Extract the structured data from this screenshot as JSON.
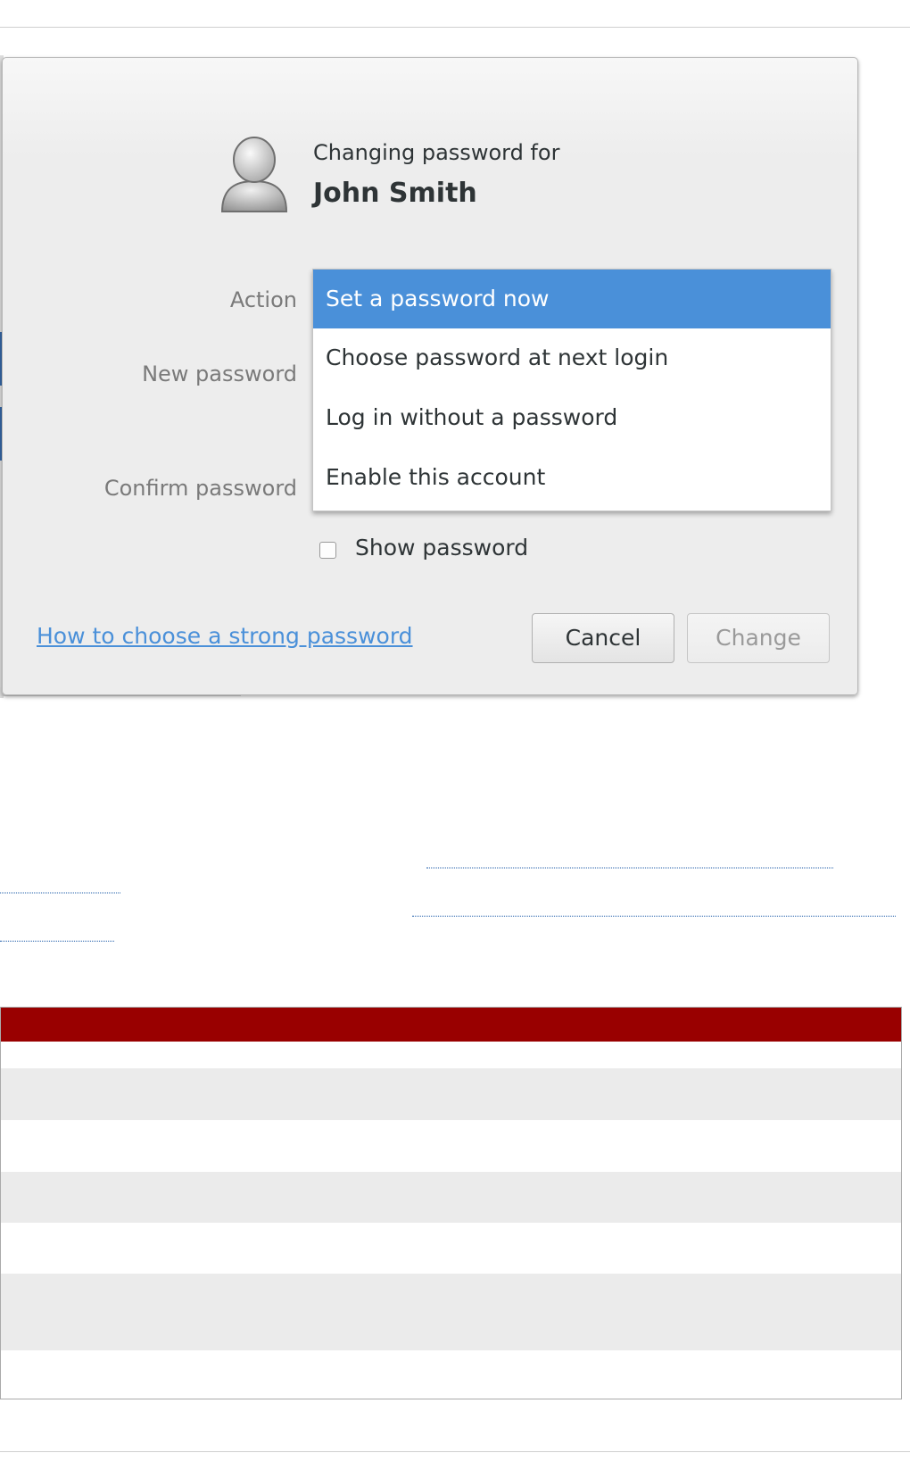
{
  "dialog": {
    "caption": "Changing password for",
    "user_name": "John Smith",
    "labels": {
      "action": "Action",
      "new_password": "New password",
      "confirm_password": "Confirm password"
    },
    "action_menu": {
      "selected_index": 0,
      "options": [
        "Set a password now",
        "Choose password at next login",
        "Log in without a password",
        "Enable this account"
      ]
    },
    "show_password": {
      "label": "Show password",
      "checked": false
    },
    "help_link": "How to choose a strong password",
    "buttons": {
      "cancel": "Cancel",
      "change": "Change"
    },
    "colors": {
      "selection": "#4a90d9",
      "link": "#4a90d9"
    }
  },
  "table": {
    "header_color": "#990000",
    "row_count": 7
  }
}
